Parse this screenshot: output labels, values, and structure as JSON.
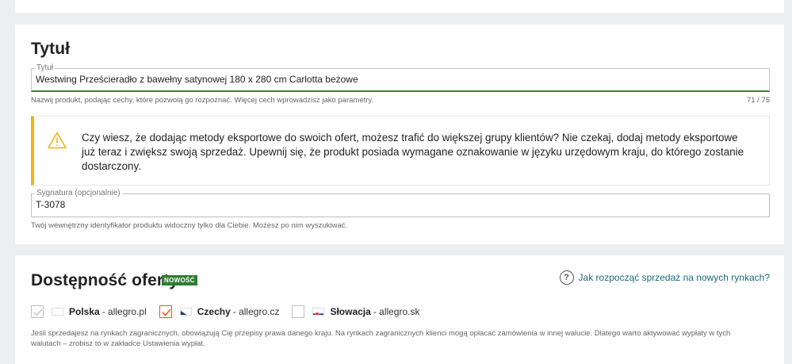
{
  "title_section": {
    "heading": "Tytuł",
    "field_label": "Tytuł",
    "field_value": "Westwing Prześcieradło z bawełny satynowej 180 x 280 cm Carlotta beżowe",
    "hint": "Nazwij produkt, podając cechy, które pozwolą go rozpoznać. Więcej cech wprowadzisz jako parametry.",
    "counter": "71  /  75",
    "alert_text": "Czy wiesz, że dodając metody eksportowe do swoich ofert, możesz trafić do większej grupy klientów? Nie czekaj, dodaj metody eksportowe już teraz i zwiększ swoją sprzedaż. Upewnij się, że produkt posiada wymagane oznakowanie w języku urzędowym kraju, do którego zostanie dostarczony.",
    "signature_label": "Sygnatura (opcjonalnie)",
    "signature_value": "T-3078",
    "signature_hint": "Twój wewnętrzny identyfikator produktu widoczny tylko dla Ciebie. Możesz po nim wyszukiwać."
  },
  "availability": {
    "heading": "Dostępność oferty",
    "badge": "NOWOŚĆ",
    "help_link": "Jak rozpocząć sprzedaż na nowych rynkach?",
    "markets": [
      {
        "name": "Polska",
        "domain": "- allegro.pl",
        "state": "checked-disabled",
        "icon": "flag-poland-icon"
      },
      {
        "name": "Czechy",
        "domain": "- allegro.cz",
        "state": "checked",
        "icon": "flag-czech-icon"
      },
      {
        "name": "Słowacja",
        "domain": "- allegro.sk",
        "state": "unchecked",
        "icon": "flag-slovakia-icon"
      }
    ],
    "info_text": "Jeśli sprzedajesz na rynkach zagranicznych, obowiązują Cię przepisy prawa danego kraju. Na rynkach zagranicznych klienci mogą opłacać zamówienia w innej walucie. Dlatego warto aktywować wypłaty w tych walutach – zrobisz to w zakładce Ustawienia wypłat."
  },
  "colors": {
    "accent_green": "#2d8a2d",
    "warning_yellow": "#f5b50f",
    "checkbox_orange": "#ff5a00",
    "link": "#1d6b7a"
  }
}
